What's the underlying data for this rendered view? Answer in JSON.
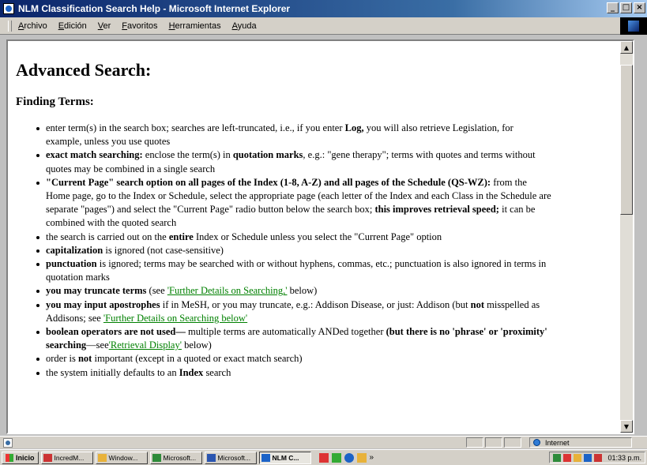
{
  "window": {
    "title": "NLM Classification Search Help - Microsoft Internet Explorer",
    "buttons": [
      "_",
      "□",
      "×"
    ]
  },
  "menu": [
    "Archivo",
    "Edición",
    "Ver",
    "Favoritos",
    "Herramientas",
    "Ayuda"
  ],
  "page": {
    "heading": "Advanced Search:",
    "subheading": "Finding Terms:"
  },
  "items": [
    "enter term(s) in the search box; searches are left-truncated, i.e., if you enter",
    "Log,",
    "you will also retrieve Legislation, for example, unless you use quotes",
    "exact match searching:",
    "enclose the term(s) in",
    "quotation marks",
    ", e.g.: \"gene therapy\"; terms with quotes and terms without quotes may be combined in a single search",
    "\"Current Page\" search option on all pages of the Index (1-8, A-Z) and all pages of the Schedule (QS-WZ):",
    "from the Home page, go to the Index or Schedule, select the appropriate page (each letter of the Index and each Class in the Schedule are separate \"pages\") and select the \"Current Page\" radio button below the search box;",
    "this improves retrieval speed;",
    "it can be combined with the quoted search",
    "the search is carried out on the",
    "entire",
    "Index or Schedule unless you select the \"Current Page\" option",
    "capitalization",
    "is ignored (not case-sensitive)",
    "punctuation",
    "is ignored; terms may be searched with or without hyphens, commas, etc.; punctuation is also ignored in terms in quotation marks",
    "you may truncate terms",
    "(see",
    "'Further Details on Searching,'",
    "below)",
    "you may input apostrophes",
    "if in MeSH, or you may truncate, e.g.: Addison Disease, or just: Addison (but",
    "not",
    "misspelled as Addisons; see",
    "'Further Details on Searching below'",
    "boolean operators are not used—",
    "multiple terms are automatically ANDed together",
    "(but there is no 'phrase' or 'proximity' searching",
    "—see",
    "'Retrieval Display'",
    "below)",
    "order is",
    "not",
    "important (except in a quoted or exact match search)",
    "the system initially defaults to an",
    "Index",
    "search"
  ],
  "statusbar": {
    "zone": "Internet"
  },
  "taskbar": {
    "start": "Inicio",
    "tasks": [
      "IncredM...",
      "Window...",
      "Microsoft...",
      "Microsoft...",
      "NLM C..."
    ],
    "chevron": "»",
    "clock": "01:33 p.m."
  },
  "colors": {
    "title_bar": "#0a246a",
    "link": "#008000",
    "chrome": "#d4d0c8"
  }
}
